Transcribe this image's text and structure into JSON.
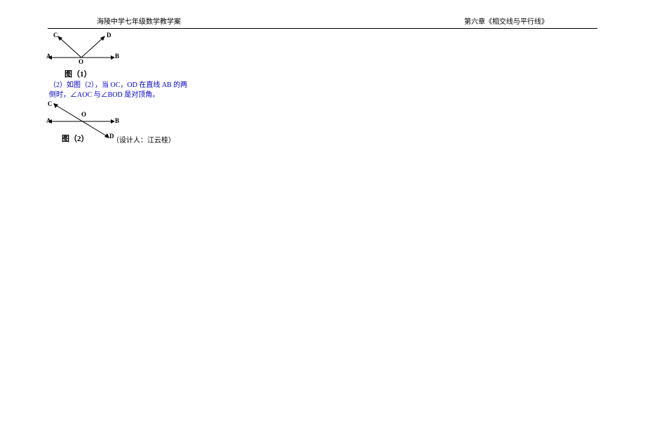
{
  "header": {
    "left": "海陵中学七年级数学教学案",
    "right": "第六章《相交线与平行线》"
  },
  "figure1": {
    "caption": "图（1）",
    "labels": {
      "A": "A",
      "B": "B",
      "C": "C",
      "D": "D",
      "O": "O"
    }
  },
  "paragraph": "（2）如图（2），当 OC，OD 在直线 AB 的两侧时，∠AOC 与∠BOD 是对顶角。",
  "figure2": {
    "caption": "图（2）",
    "labels": {
      "A": "A",
      "B": "B",
      "C": "C",
      "D": "D",
      "O": "O"
    }
  },
  "designer": "（设计人：江云桂）"
}
